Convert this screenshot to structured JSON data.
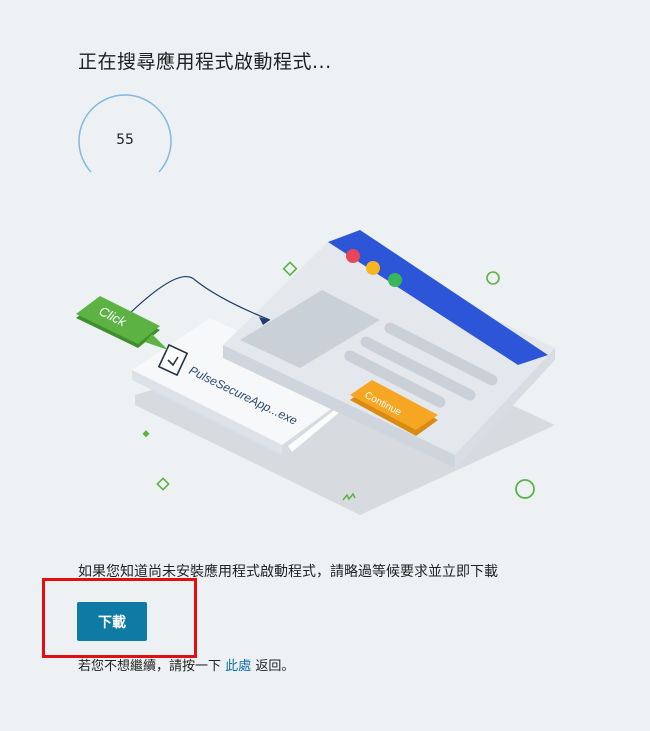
{
  "title": "正在搜尋應用程式啟動程式...",
  "countdown": {
    "value": "55"
  },
  "illustration": {
    "click_label": "Click",
    "file_name": "PulseSecureApp...exe",
    "continue_label": "Continue"
  },
  "instruction": "如果您知道尚未安裝應用程式啟動程式，請略過等候要求並立即下載",
  "download_button": "下載",
  "back": {
    "prefix": "若您不想繼續，請按一下",
    "link": "此處",
    "suffix": "返回。"
  },
  "colors": {
    "background": "#eef1f4",
    "button": "#0f7aa3",
    "link": "#0f6ea6",
    "browser_bar": "#2d55d8",
    "click_green": "#5cb343",
    "continue_orange": "#f5a623",
    "highlight_red": "#e01010"
  }
}
